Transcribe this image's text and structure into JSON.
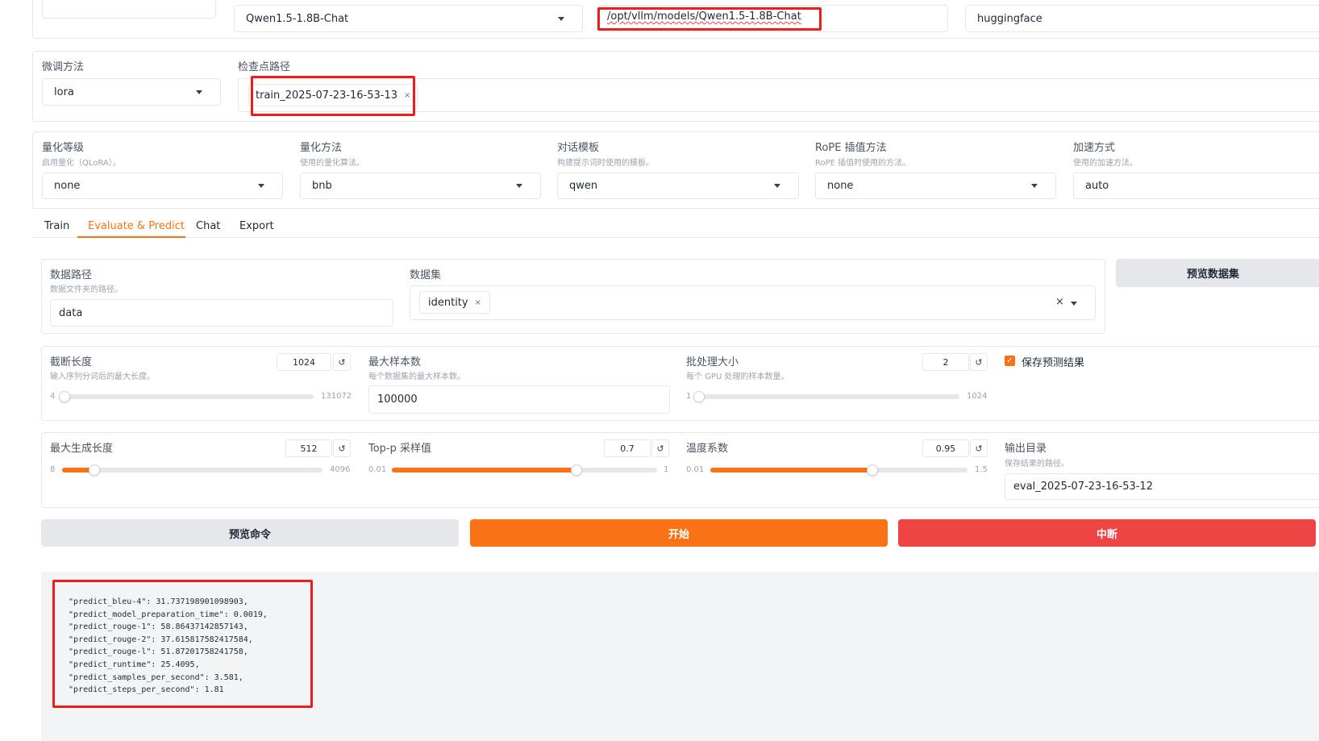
{
  "model_row": {
    "model_name": "Qwen1.5-1.8B-Chat",
    "model_path": "/opt/vllm/models/Qwen1.5-1.8B-Chat",
    "hub": "huggingface"
  },
  "finetune": {
    "method_label": "微调方法",
    "method_value": "lora",
    "checkpoint_label": "检查点路径",
    "checkpoint_tag": "train_2025-07-23-16-53-13",
    "remove_icon": "×"
  },
  "quant": {
    "bit_label": "量化等级",
    "bit_info": "启用量化（QLoRA）。",
    "bit_value": "none",
    "method_label": "量化方法",
    "method_info": "使用的量化算法。",
    "method_value": "bnb",
    "template_label": "对话模板",
    "template_info": "构建提示词时使用的模板。",
    "template_value": "qwen",
    "rope_label": "RoPE 插值方法",
    "rope_info": "RoPE 插值时使用的方法。",
    "rope_value": "none",
    "booster_label": "加速方式",
    "booster_info": "使用的加速方法。",
    "booster_value": "auto"
  },
  "tabs": [
    {
      "label": "Train"
    },
    {
      "label": "Evaluate & Predict"
    },
    {
      "label": "Chat"
    },
    {
      "label": "Export"
    }
  ],
  "data_section": {
    "dir_label": "数据路径",
    "dir_info": "数据文件夹的路径。",
    "dir_value": "data",
    "dataset_label": "数据集",
    "dataset_tag": "identity",
    "tag_remove": "×",
    "clear_icon": "×",
    "preview_button": "预览数据集"
  },
  "params1": {
    "cutoff_label": "截断长度",
    "cutoff_info": "输入序列分词后的最大长度。",
    "cutoff_value": "1024",
    "cutoff_min": "4",
    "cutoff_max": "131072",
    "cutoff_fraction": 0.008,
    "max_samples_label": "最大样本数",
    "max_samples_info": "每个数据集的最大样本数。",
    "max_samples_value": "100000",
    "batch_label": "批处理大小",
    "batch_info": "每个 GPU 处理的样本数量。",
    "batch_value": "2",
    "batch_min": "1",
    "batch_max": "1024",
    "batch_fraction": 0.001,
    "save_pred_label": "保存预测结果",
    "check_mark": "✓",
    "reset_icon": "↺"
  },
  "params2": {
    "max_new_label": "最大生成长度",
    "max_new_value": "512",
    "max_new_min": "8",
    "max_new_max": "4096",
    "max_new_fraction": 0.123,
    "top_p_label": "Top-p 采样值",
    "top_p_value": "0.7",
    "top_p_min": "0.01",
    "top_p_max": "1",
    "top_p_fraction": 0.697,
    "temp_label": "温度系数",
    "temp_value": "0.95",
    "temp_min": "0.01",
    "temp_max": "1.5",
    "temp_fraction": 0.631,
    "output_label": "输出目录",
    "output_info": "保存结果的路径。",
    "output_value": "eval_2025-07-23-16-53-12"
  },
  "buttons": {
    "preview_cmd": "预览命令",
    "start": "开始",
    "stop": "中断"
  },
  "output_text": "  \"predict_bleu-4\": 31.737198901098903,\n  \"predict_model_preparation_time\": 0.0019,\n  \"predict_rouge-1\": 58.86437142857143,\n  \"predict_rouge-2\": 37.615817582417584,\n  \"predict_rouge-l\": 51.87201758241758,\n  \"predict_runtime\": 25.4095,\n  \"predict_samples_per_second\": 3.581,\n  \"predict_steps_per_second\": 1.81",
  "colors": {
    "accent": "#f97316",
    "danger": "#ef4444",
    "highlight": "#ef1c1c",
    "neutral_button": "#e5e7eb"
  }
}
